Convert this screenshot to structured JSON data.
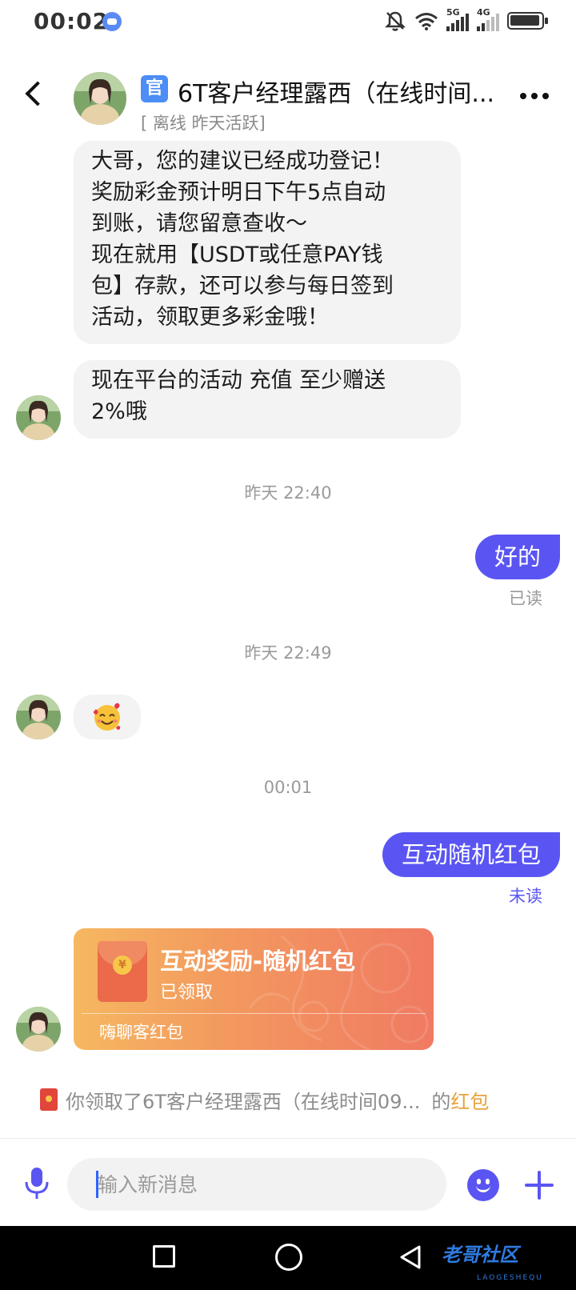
{
  "status_bar": {
    "time": "00:02",
    "network_5g": "5G",
    "network_4g": "4G"
  },
  "header": {
    "badge": "官",
    "title": "6T客户经理露西（在线时间...",
    "status": "[ 离线  昨天活跃]"
  },
  "messages": [
    {
      "type": "incoming",
      "lines": [
        "大哥，您的建议已经成功登记！",
        "奖励彩金预计明日下午5点自动",
        "到账，请您留意查收～",
        "现在就用【USDT或任意PAY钱",
        "包】存款，还可以参与每日签到",
        "活动，领取更多彩金哦！"
      ]
    },
    {
      "type": "incoming",
      "lines": [
        "现在平台的活动 充值 至少赠送",
        "2%哦"
      ]
    },
    {
      "type": "timestamp",
      "text": "昨天 22:40"
    },
    {
      "type": "outgoing",
      "text": "好的",
      "receipt": "已读",
      "receipt_color": "#999999"
    },
    {
      "type": "timestamp",
      "text": "昨天 22:49"
    },
    {
      "type": "incoming",
      "emoji": "🥰"
    },
    {
      "type": "timestamp",
      "text": "00:01"
    },
    {
      "type": "outgoing",
      "text": "互动随机红包",
      "receipt": "未读",
      "receipt_color": "#5a55f2"
    },
    {
      "type": "red_packet",
      "title": "互动奖励-随机红包",
      "status": "已领取",
      "brand": "嗨聊客红包",
      "coin": "¥"
    }
  ],
  "notice": {
    "text": "你领取了6T客户经理露西（在线时间09...",
    "mid": "的",
    "link": "红包"
  },
  "input_bar": {
    "placeholder": "输入新消息"
  },
  "nav_bar": {
    "watermark": "老哥社区",
    "watermark_sub": "LAOGESHEQU"
  },
  "colors": {
    "accent": "#5a55f2",
    "bubble_in": "#f3f3f3",
    "packet_start": "#f6b860",
    "packet_end": "#f07a62",
    "notice_link": "#e8a23a",
    "badge": "#4c8df6"
  }
}
